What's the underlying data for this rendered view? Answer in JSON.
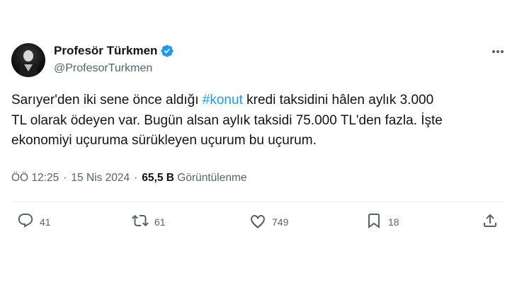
{
  "tweet": {
    "author_name": "Profesör Türkmen",
    "author_handle": "@ProfesorTurkmen",
    "text_line1_pre": "Sarıyer'den iki sene önce aldığı ",
    "hashtag": "#konut",
    "text_line1_post": " kredi taksidini hâlen aylık 3.000",
    "text_line2": "TL olarak ödeyen var. Bugün alsan aylık taksidi 75.000 TL'den fazla. İşte",
    "text_line3": "ekonomiyi uçuruma sürükleyen uçurum bu uçurum.",
    "time": "ÖÖ 12:25",
    "separator": "·",
    "date": "15 Nis 2024",
    "views_count": "65,5 B",
    "views_label": "Görüntülenme"
  },
  "actions": {
    "replies": "41",
    "retweets": "61",
    "likes": "749",
    "bookmarks": "18"
  },
  "colors": {
    "accent": "#1d9bf0",
    "secondary_text": "#536471",
    "primary_text": "#0f1419"
  }
}
